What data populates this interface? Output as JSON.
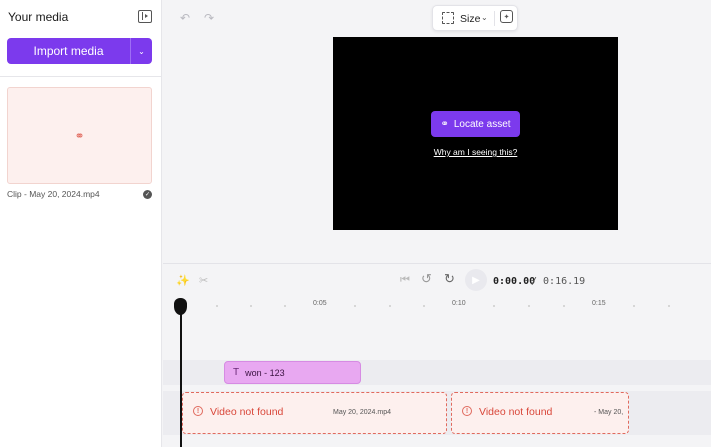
{
  "sidebar": {
    "title": "Your media",
    "import_label": "Import media",
    "media_item": {
      "name": "Clip - May 20, 2024.mp4"
    }
  },
  "toolbar": {
    "size_label": "Size"
  },
  "preview": {
    "locate_label": "Locate asset",
    "why_label": "Why am I seeing this?"
  },
  "playback": {
    "current_time": "0:00.00",
    "total_time": "/ 0:16.19"
  },
  "ruler": {
    "labels": [
      "0:05",
      "0:10",
      "0:15"
    ]
  },
  "tracks": {
    "text_clip": "won - 123",
    "missing_clips": [
      {
        "label": "Video not found",
        "file": "May 20, 2024.mp4"
      },
      {
        "label": "Video not found",
        "file": "- May 20,"
      }
    ]
  },
  "colors": {
    "accent": "#7c3aed",
    "error": "#d9473a",
    "text_clip": "#e8a8f1"
  },
  "icons": {
    "sidebar_toggle": "panel-collapse-icon",
    "link": "link-icon",
    "check": "check-circle-icon",
    "undo": "undo-icon",
    "redo": "redo-icon",
    "crop": "resize-icon",
    "magic": "magic-resize-icon",
    "play": "play-icon",
    "warning": "alert-circle-icon"
  }
}
